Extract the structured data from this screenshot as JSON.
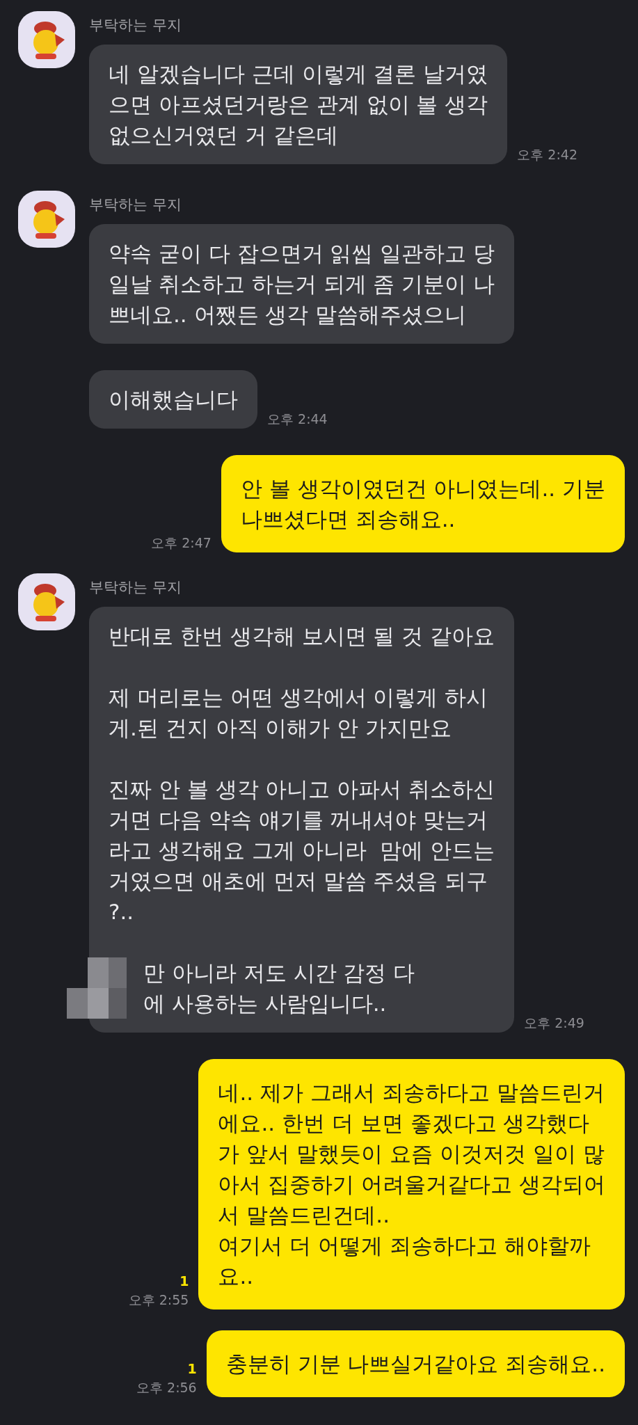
{
  "messages": [
    {
      "kind": "received",
      "sender": "부탁하는 무지",
      "bubbles": [
        {
          "paragraphs": [
            {
              "text": "네 알겠습니다 근데 이렇게 결론 날거였\n으면 아프셨던거랑은 관계 없이 볼 생각\n없으신거였던 거 같은데",
              "censored": false
            }
          ]
        }
      ],
      "time": "오후 2:42"
    },
    {
      "kind": "received",
      "sender": "부탁하는 무지",
      "bubbles": [
        {
          "paragraphs": [
            {
              "text": "약속 굳이 다 잡으면거 읽씹 일관하고 당\n일날 취소하고 하는거 되게 좀 기분이 나\n쁘네요.. 어쨌든 생각 말씀해주셨으니",
              "censored": false
            }
          ]
        },
        {
          "paragraphs": [
            {
              "text": "이해했습니다",
              "censored": false
            }
          ]
        }
      ],
      "time": "오후 2:44"
    },
    {
      "kind": "sent",
      "bubbles": [
        {
          "paragraphs": [
            {
              "text": "안 볼 생각이였던건 아니였는데.. 기분\n나쁘셨다면 죄송해요..",
              "censored": false
            }
          ]
        }
      ],
      "time": "오후 2:47"
    },
    {
      "kind": "received",
      "sender": "부탁하는 무지",
      "bubbles": [
        {
          "paragraphs": [
            {
              "text": "반대로 한번 생각해 보시면 될 것 같아요",
              "censored": false
            },
            {
              "text": "제 머리로는 어떤 생각에서 이렇게 하시\n게.된 건지 아직 이해가 안 가지만요",
              "censored": false
            },
            {
              "text": "진짜 안 볼 생각 아니고 아파서 취소하신\n거면 다음 약속 얘기를 꺼내셔야 맞는거\n라고 생각해요 그게 아니라  맘에 안드는\n거였으면 애초에 먼저 말씀 주셨음 되구\n?..",
              "censored": false
            },
            {
              "text": "만 아니라 저도 시간 감정 다\n에 사용하는 사람입니다..",
              "censored": true
            }
          ]
        }
      ],
      "time": "오후 2:49"
    },
    {
      "kind": "sent",
      "bubbles": [
        {
          "paragraphs": [
            {
              "text": "네.. 제가 그래서 죄송하다고 말씀드린거\n에요.. 한번 더 보면 좋겠다고 생각했다\n가 앞서 말했듯이 요즘 이것저것 일이 많\n아서 집중하기 어려울거같다고 생각되어\n서 말씀드린건데..\n여기서 더 어떻게 죄송하다고 해야할까\n요..",
              "censored": false
            }
          ]
        }
      ],
      "unread": "1",
      "time": "오후 2:55"
    },
    {
      "kind": "sent",
      "bubbles": [
        {
          "paragraphs": [
            {
              "text": "충분히 기분 나쁘실거같아요 죄송해요..",
              "censored": false
            }
          ]
        }
      ],
      "unread": "1",
      "time": "오후 2:56"
    }
  ]
}
